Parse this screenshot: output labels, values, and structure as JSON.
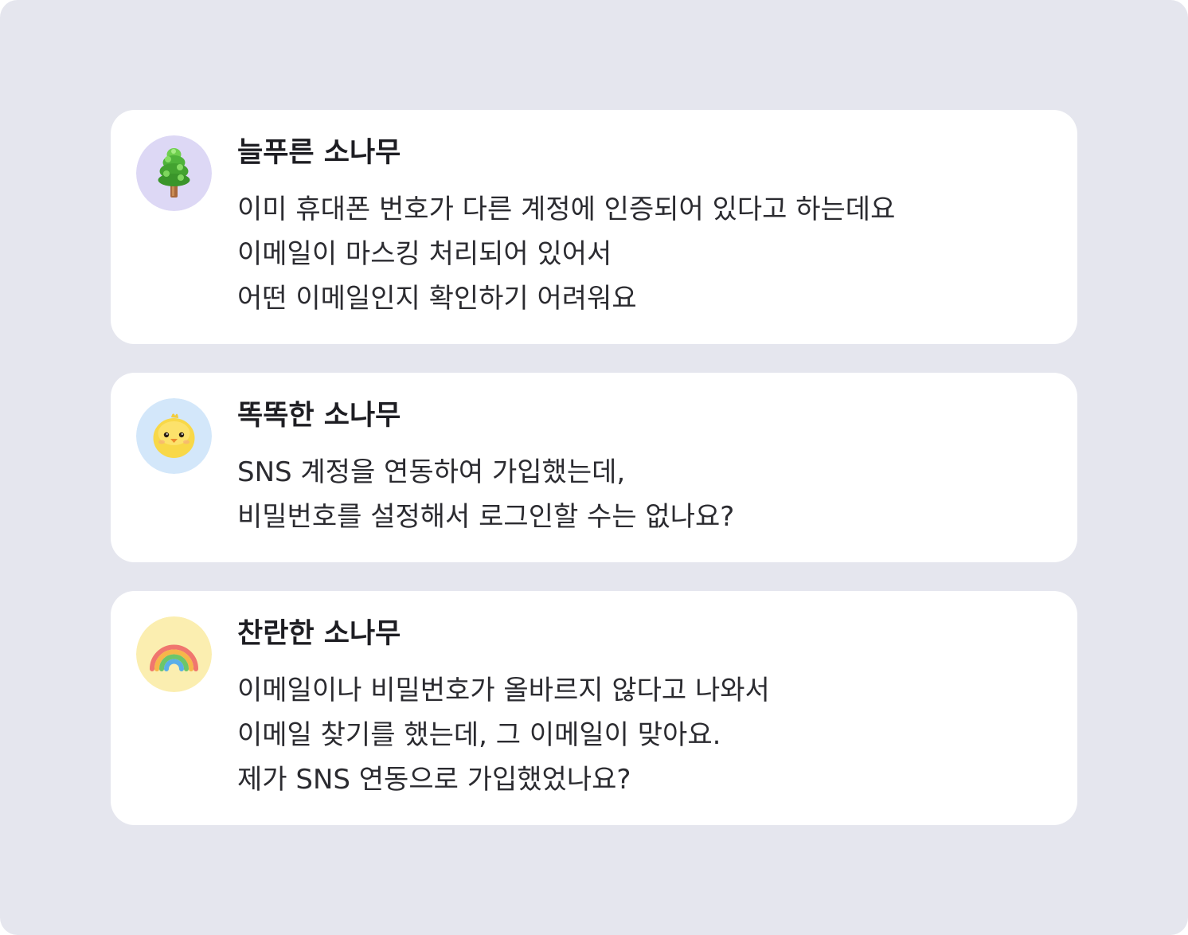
{
  "colors": {
    "page_background": "#e5e6ee",
    "card_background": "#ffffff",
    "name_text": "#1d1d22",
    "message_text": "#2b2b30"
  },
  "comments": [
    {
      "name": "늘푸른 소나무",
      "avatar_icon": "pine-tree-icon",
      "avatar_bg": "#ddd8f5",
      "lines": [
        "이미 휴대폰 번호가 다른 계정에 인증되어 있다고 하는데요",
        "이메일이 마스킹 처리되어 있어서",
        "어떤 이메일인지 확인하기 어려워요"
      ]
    },
    {
      "name": "똑똑한 소나무",
      "avatar_icon": "chick-icon",
      "avatar_bg": "#d3e7fa",
      "lines": [
        "SNS 계정을 연동하여 가입했는데,",
        "비밀번호를 설정해서 로그인할 수는 없나요?"
      ]
    },
    {
      "name": "찬란한 소나무",
      "avatar_icon": "rainbow-icon",
      "avatar_bg": "#fbeeb0",
      "lines": [
        "이메일이나 비밀번호가 올바르지 않다고 나와서",
        "이메일 찾기를 했는데, 그 이메일이 맞아요.",
        "제가 SNS 연동으로 가입했었나요?"
      ]
    }
  ]
}
